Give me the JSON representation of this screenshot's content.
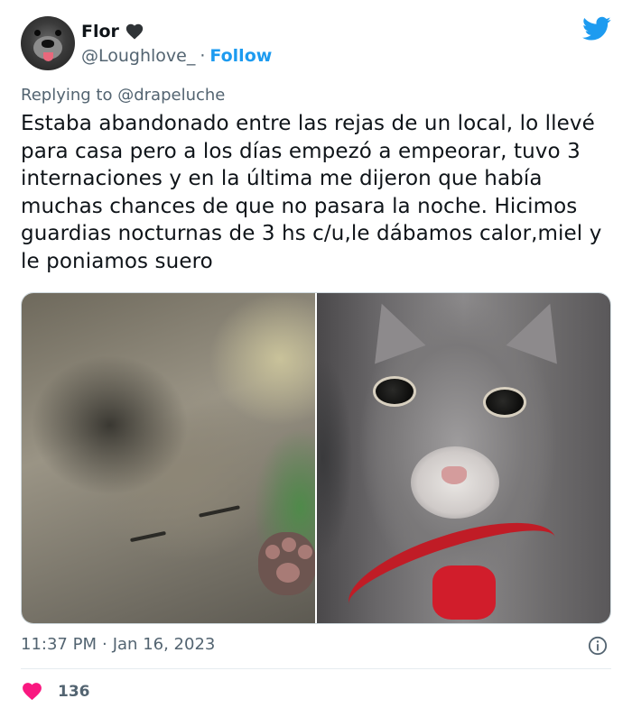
{
  "author": {
    "name": "Flor",
    "handle": "@Loughlove_",
    "separator": "·",
    "follow_label": "Follow"
  },
  "reply": {
    "prefix": "Replying to",
    "to": "@drapeluche"
  },
  "tweet": {
    "text": "Estaba abandonado entre las rejas de un local, lo llevé para casa pero a los días empezó a empeorar, tuvo 3 internaciones y en la última me dijeron que había muchas chances de que no pasara la noche. Hicimos guardias nocturnas de 3 hs c/u,le dábamos calor,miel y le poniamos suero"
  },
  "meta": {
    "time": "11:37 PM",
    "separator": "·",
    "date": "Jan 16, 2023"
  },
  "engagement": {
    "likes": "136"
  },
  "icons": {
    "name_emoji": "black-heart-icon",
    "brand": "twitter-bird-icon",
    "info": "info-icon",
    "like": "heart-icon"
  },
  "colors": {
    "brand": "#1d9bf0",
    "secondary_text": "#536471",
    "like": "#f91880"
  }
}
